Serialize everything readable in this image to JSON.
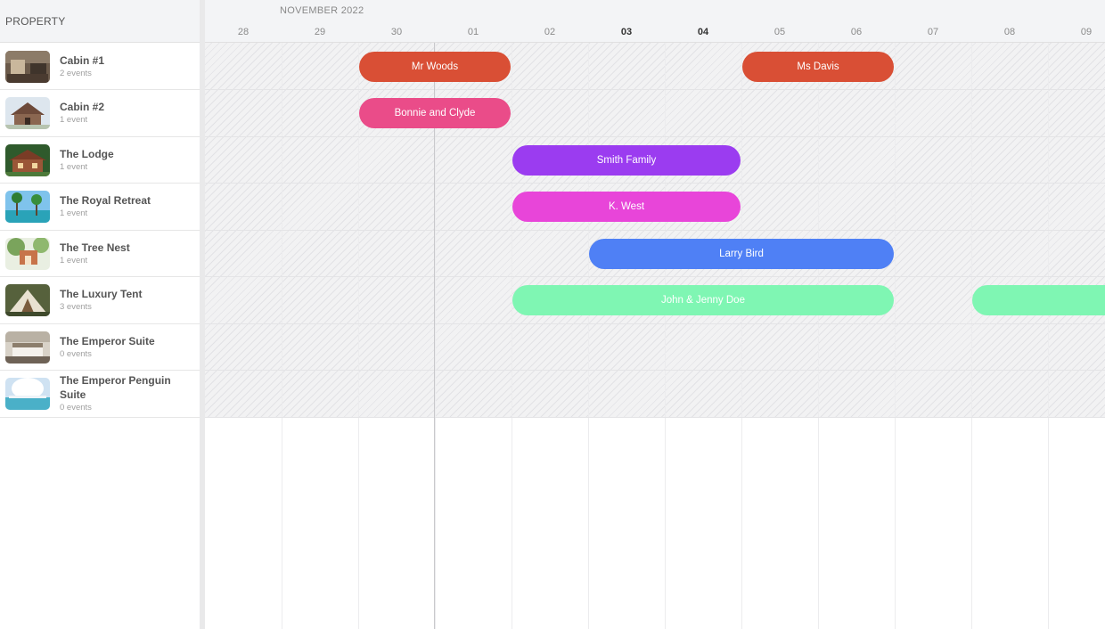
{
  "sidebar": {
    "header": "PROPERTY",
    "properties": [
      {
        "name": "Cabin #1",
        "events": "2 events",
        "thumb": "cabin-interior"
      },
      {
        "name": "Cabin #2",
        "events": "1 event",
        "thumb": "chalet"
      },
      {
        "name": "The Lodge",
        "events": "1 event",
        "thumb": "lodge"
      },
      {
        "name": "The Royal Retreat",
        "events": "1 event",
        "thumb": "palm-beach"
      },
      {
        "name": "The Tree Nest",
        "events": "1 event",
        "thumb": "treehouse"
      },
      {
        "name": "The Luxury Tent",
        "events": "3 events",
        "thumb": "tent"
      },
      {
        "name": "The Emperor Suite",
        "events": "0 events",
        "thumb": "suite-room"
      },
      {
        "name": "The Emperor Penguin Suite",
        "events": "0 events",
        "thumb": "penguin-suite"
      }
    ]
  },
  "timeline": {
    "month": "NOVEMBER 2022",
    "days": [
      {
        "label": "28",
        "bold": false
      },
      {
        "label": "29",
        "bold": false
      },
      {
        "label": "30",
        "bold": false
      },
      {
        "label": "01",
        "bold": false
      },
      {
        "label": "02",
        "bold": false
      },
      {
        "label": "03",
        "bold": true
      },
      {
        "label": "04",
        "bold": true
      },
      {
        "label": "05",
        "bold": false
      },
      {
        "label": "06",
        "bold": false
      },
      {
        "label": "07",
        "bold": false
      },
      {
        "label": "08",
        "bold": false
      },
      {
        "label": "09",
        "bold": false
      }
    ],
    "events": [
      {
        "label": "Mr Woods",
        "row": 0,
        "start": 2,
        "span": 2,
        "color": "#d94f35",
        "textColor": "#ffffff"
      },
      {
        "label": "Ms Davis",
        "row": 0,
        "start": 7,
        "span": 2,
        "color": "#d94f35",
        "textColor": "#ffffff"
      },
      {
        "label": "Bonnie and Clyde",
        "row": 1,
        "start": 2,
        "span": 2,
        "color": "#ea4c89",
        "textColor": "#ffffff"
      },
      {
        "label": "Smith Family",
        "row": 2,
        "start": 4,
        "span": 3,
        "color": "#9b3cf0",
        "textColor": "#ffffff"
      },
      {
        "label": "K. West",
        "row": 3,
        "start": 4,
        "span": 3,
        "color": "#e845d9",
        "textColor": "#ffffff"
      },
      {
        "label": "Larry Bird",
        "row": 4,
        "start": 5,
        "span": 4,
        "color": "#4f80f5",
        "textColor": "#ffffff"
      },
      {
        "label": "John & Jenny Doe",
        "row": 5,
        "start": 4,
        "span": 5,
        "color": "#7ff6b3",
        "textColor": "#ffffff"
      },
      {
        "label": "",
        "row": 5,
        "start": 10,
        "span": 2,
        "color": "#7ff6b3",
        "textColor": "#ffffff"
      }
    ]
  }
}
